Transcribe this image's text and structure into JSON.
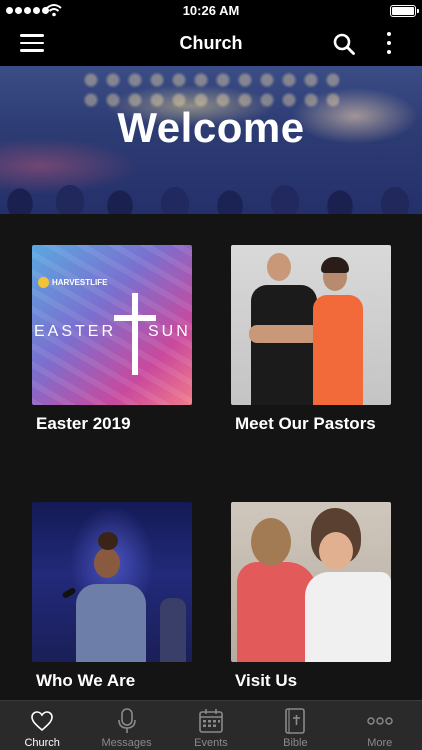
{
  "status_bar": {
    "time": "10:26 AM",
    "signal_icon": "signal-dots-icon",
    "wifi_icon": "wifi-icon",
    "battery_icon": "battery-icon"
  },
  "nav": {
    "title": "Church",
    "menu_icon": "hamburger-menu-icon",
    "search_icon": "search-icon",
    "more_icon": "vertical-dots-icon"
  },
  "hero": {
    "title": "Welcome"
  },
  "tiles": [
    {
      "label": "Easter 2019",
      "image_text": {
        "brand": "HARVESTLIFE",
        "left_word": "EASTER",
        "right_word": "SUN"
      }
    },
    {
      "label": "Meet Our Pastors"
    },
    {
      "label": "Who We Are"
    },
    {
      "label": "Visit Us"
    }
  ],
  "tab_bar": {
    "items": [
      {
        "label": "Church",
        "icon": "heart-icon",
        "active": true
      },
      {
        "label": "Messages",
        "icon": "microphone-icon",
        "active": false
      },
      {
        "label": "Events",
        "icon": "calendar-icon",
        "active": false
      },
      {
        "label": "Bible",
        "icon": "bible-book-icon",
        "active": false
      },
      {
        "label": "More",
        "icon": "horizontal-dots-icon",
        "active": false
      }
    ]
  },
  "colors": {
    "background": "#141414",
    "bar": "#000000",
    "tab_bar": "#2a2a2a",
    "tab_inactive": "#8a8a8a",
    "tab_active": "#ffffff"
  }
}
